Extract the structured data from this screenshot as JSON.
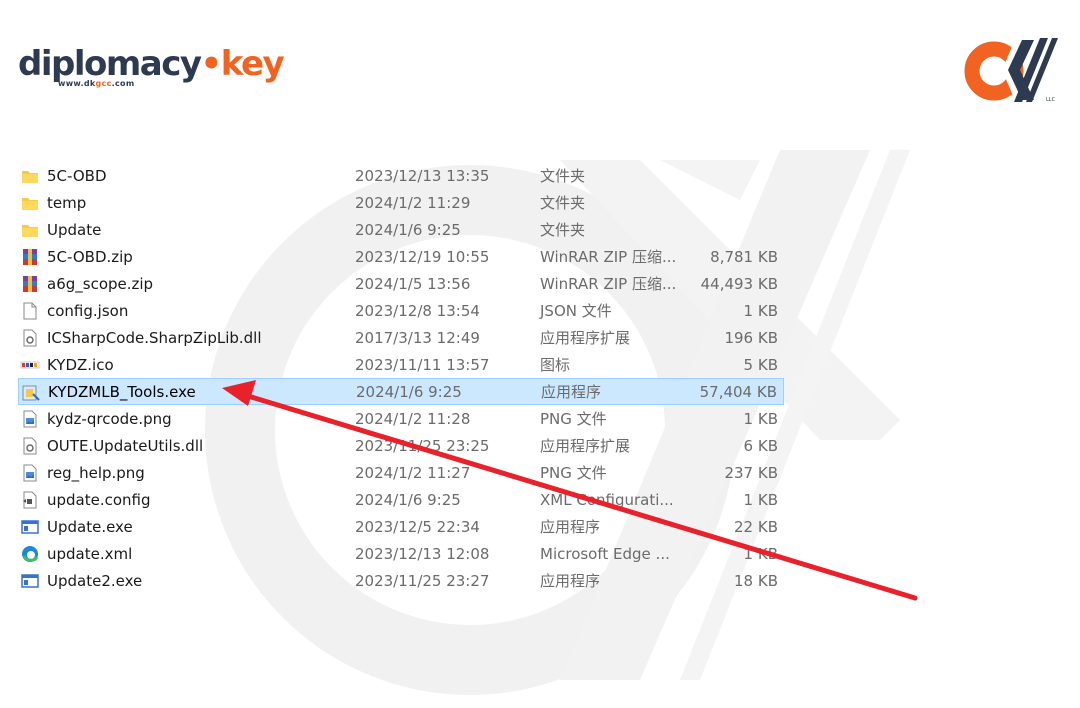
{
  "brand": {
    "name_part1": "diplomacy",
    "name_dot": "•",
    "name_part2": "key",
    "url_prefix": "www.dk",
    "url_highlight": "gcc",
    "url_suffix": ".com"
  },
  "corner_logo": {
    "suffix": "LLC"
  },
  "colors": {
    "brand_orange": "#f26322",
    "brand_navy": "#2d3a4f",
    "selection": "#cce8ff",
    "arrow": "#e8212a"
  },
  "files": [
    {
      "name": "5C-OBD",
      "date": "2023/12/13 13:35",
      "type": "文件夹",
      "size": "",
      "icon": "folder-icon"
    },
    {
      "name": "temp",
      "date": "2024/1/2 11:29",
      "type": "文件夹",
      "size": "",
      "icon": "folder-icon"
    },
    {
      "name": "Update",
      "date": "2024/1/6 9:25",
      "type": "文件夹",
      "size": "",
      "icon": "folder-icon"
    },
    {
      "name": "5C-OBD.zip",
      "date": "2023/12/19 10:55",
      "type": "WinRAR ZIP 压缩...",
      "size": "8,781 KB",
      "icon": "winrar-archive-icon"
    },
    {
      "name": "a6g_scope.zip",
      "date": "2024/1/5 13:56",
      "type": "WinRAR ZIP 压缩...",
      "size": "44,493 KB",
      "icon": "winrar-archive-icon"
    },
    {
      "name": "config.json",
      "date": "2023/12/8 13:54",
      "type": "JSON 文件",
      "size": "1 KB",
      "icon": "blank-file-icon"
    },
    {
      "name": "ICSharpCode.SharpZipLib.dll",
      "date": "2017/3/13 12:49",
      "type": "应用程序扩展",
      "size": "196 KB",
      "icon": "dll-file-icon"
    },
    {
      "name": "KYDZ.ico",
      "date": "2023/11/11 13:57",
      "type": "图标",
      "size": "5 KB",
      "icon": "kydz-icon"
    },
    {
      "name": "KYDZMLB_Tools.exe",
      "date": "2024/1/6 9:25",
      "type": "应用程序",
      "size": "57,404 KB",
      "icon": "installer-exe-icon",
      "selected": true
    },
    {
      "name": "kydz-qrcode.png",
      "date": "2024/1/2 11:28",
      "type": "PNG 文件",
      "size": "1 KB",
      "icon": "image-file-icon"
    },
    {
      "name": "OUTE.UpdateUtils.dll",
      "date": "2023/11/25 23:25",
      "type": "应用程序扩展",
      "size": "6 KB",
      "icon": "dll-file-icon"
    },
    {
      "name": "reg_help.png",
      "date": "2024/1/2 11:27",
      "type": "PNG 文件",
      "size": "237 KB",
      "icon": "image-file-icon"
    },
    {
      "name": "update.config",
      "date": "2024/1/6 9:25",
      "type": "XML Configurati...",
      "size": "1 KB",
      "icon": "config-file-icon"
    },
    {
      "name": "Update.exe",
      "date": "2023/12/5 22:34",
      "type": "应用程序",
      "size": "22 KB",
      "icon": "exe-window-icon"
    },
    {
      "name": "update.xml",
      "date": "2023/12/13 12:08",
      "type": "Microsoft Edge ...",
      "size": "1 KB",
      "icon": "edge-icon"
    },
    {
      "name": "Update2.exe",
      "date": "2023/11/25 23:27",
      "type": "应用程序",
      "size": "18 KB",
      "icon": "exe-window-icon"
    }
  ]
}
